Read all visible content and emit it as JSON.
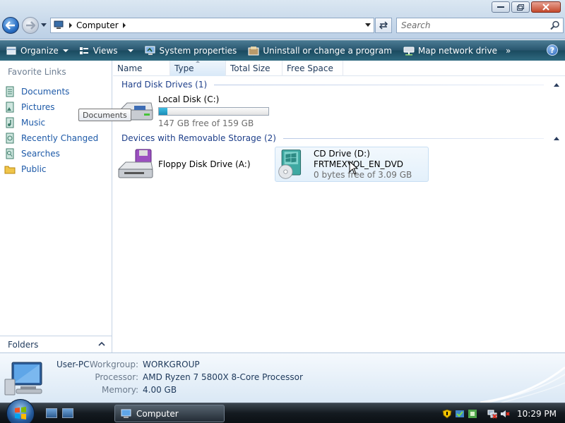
{
  "window": {
    "address_location": "Computer",
    "search_placeholder": "Search"
  },
  "toolbar": {
    "organize": "Organize",
    "views": "Views",
    "system_properties": "System properties",
    "uninstall": "Uninstall or change a program",
    "map_network_drive": "Map network drive",
    "more": "»",
    "help": "?"
  },
  "nav": {
    "favorite_links_title": "Favorite Links",
    "items": [
      {
        "label": "Documents",
        "icon": "documents-icon"
      },
      {
        "label": "Pictures",
        "icon": "pictures-icon"
      },
      {
        "label": "Music",
        "icon": "music-icon"
      },
      {
        "label": "Recently Changed",
        "icon": "recently-changed-icon"
      },
      {
        "label": "Searches",
        "icon": "searches-icon"
      },
      {
        "label": "Public",
        "icon": "public-folder-icon"
      }
    ],
    "folders_label": "Folders",
    "tooltip": "Documents"
  },
  "columns": [
    "Name",
    "Type",
    "Total Size",
    "Free Space"
  ],
  "groups": {
    "hard_disk": {
      "title": "Hard Disk Drives (1)",
      "drives": [
        {
          "name": "Local Disk (C:)",
          "space": "147 GB free of 159 GB",
          "used_fraction": 0.075
        }
      ]
    },
    "removable": {
      "title": "Devices with Removable Storage (2)",
      "drives": [
        {
          "name": "Floppy Disk Drive (A:)"
        },
        {
          "name": "CD Drive (D:)",
          "label": "FRTMEXVOL_EN_DVD",
          "space": "0 bytes free of 3.09 GB"
        }
      ]
    }
  },
  "details": {
    "pc_name": "User-PC",
    "workgroup_label": "Workgroup:",
    "workgroup": "WORKGROUP",
    "processor_label": "Processor:",
    "processor": "AMD Ryzen 7 5800X 8-Core Processor",
    "memory_label": "Memory:",
    "memory": "4.00 GB"
  },
  "taskbar": {
    "task_label": "Computer",
    "clock": "10:29 PM"
  }
}
